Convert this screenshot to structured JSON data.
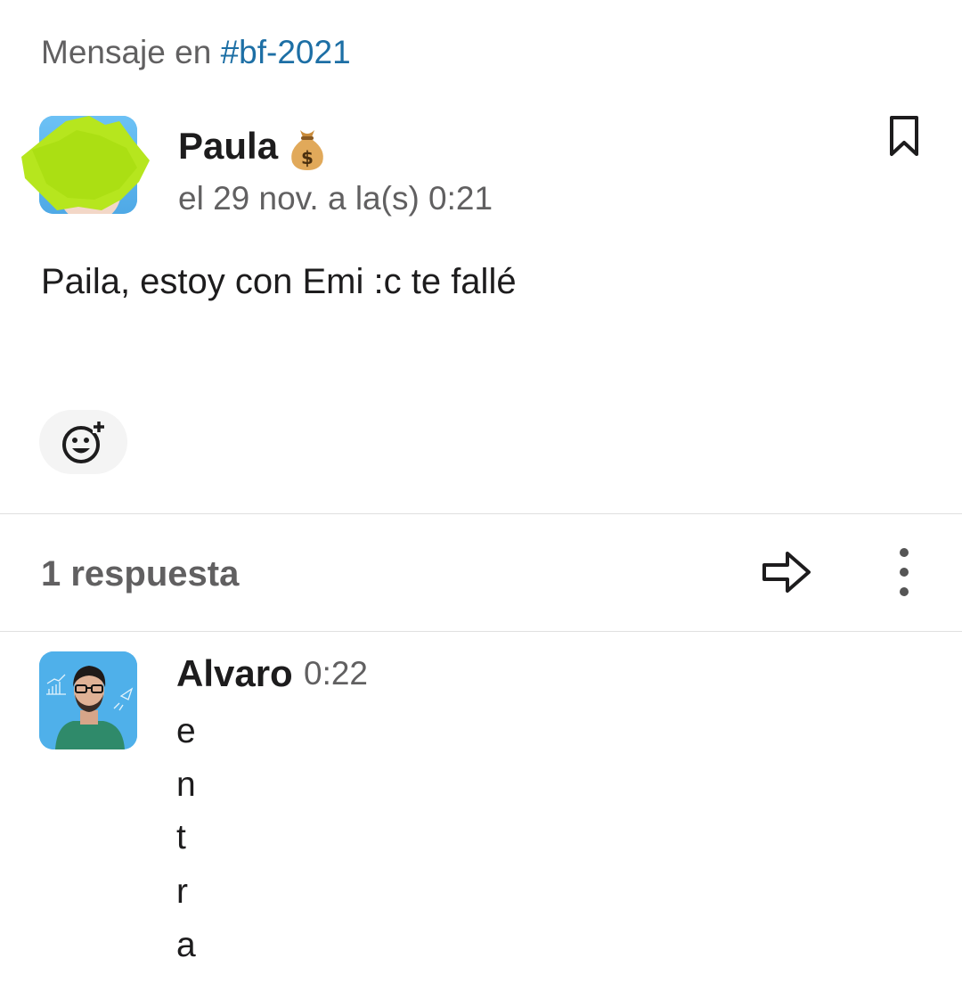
{
  "header": {
    "prefix": "Mensaje en ",
    "channel": "#bf-2021"
  },
  "message": {
    "author": "Paula",
    "author_emoji": "money-bag-icon",
    "timestamp": "el 29 nov. a la(s) 0:21",
    "text": "Paila, estoy con Emi :c te fallé"
  },
  "thread": {
    "replies_label": "1 respuesta"
  },
  "reply": {
    "author": "Alvaro",
    "time": "0:22",
    "lines": [
      "e",
      "n",
      "t",
      "r",
      "a"
    ]
  },
  "colors": {
    "link": "#1d6fa5",
    "muted_text": "#616061",
    "main_text": "#1d1c1d",
    "redaction_scribble": "#b6e61e"
  }
}
